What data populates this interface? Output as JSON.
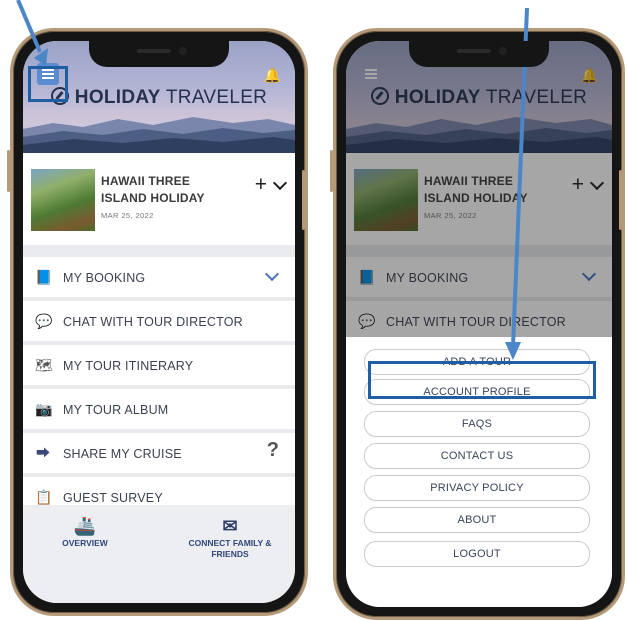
{
  "app": {
    "brand_bold": "HOLIDAY",
    "brand_light": "TRAVELER"
  },
  "tour": {
    "title": "HAWAII THREE ISLAND HOLIDAY",
    "date": "MAR 25, 2022",
    "add_icon": "+",
    "expand_icon": "chevron-down-icon"
  },
  "menu": {
    "items": [
      {
        "label": "MY BOOKING",
        "icon": "booking-icon"
      },
      {
        "label": "CHAT WITH TOUR DIRECTOR",
        "icon": "chat-icon"
      },
      {
        "label": "MY TOUR ITINERARY",
        "icon": "map-icon"
      },
      {
        "label": "MY TOUR ALBUM",
        "icon": "camera-icon"
      },
      {
        "label": "SHARE MY CRUISE",
        "icon": "share-icon"
      },
      {
        "label": "GUEST SURVEY",
        "icon": "clipboard-icon"
      }
    ],
    "help_label": "?"
  },
  "bottom_nav": [
    {
      "label": "OVERVIEW",
      "icon": "ship-icon"
    },
    {
      "label": "CONNECT FAMILY & FRIENDS",
      "icon": "envelope-icon"
    }
  ],
  "sheet": {
    "buttons": [
      "ADD A TOUR",
      "ACCOUNT PROFILE",
      "FAQS",
      "CONTACT US",
      "PRIVACY POLICY",
      "ABOUT",
      "LOGOUT"
    ]
  },
  "colors": {
    "annotation": "#4a86c8",
    "highlight": "#1f5ea3",
    "brand": "#24324f",
    "accent": "#4b72c4"
  }
}
